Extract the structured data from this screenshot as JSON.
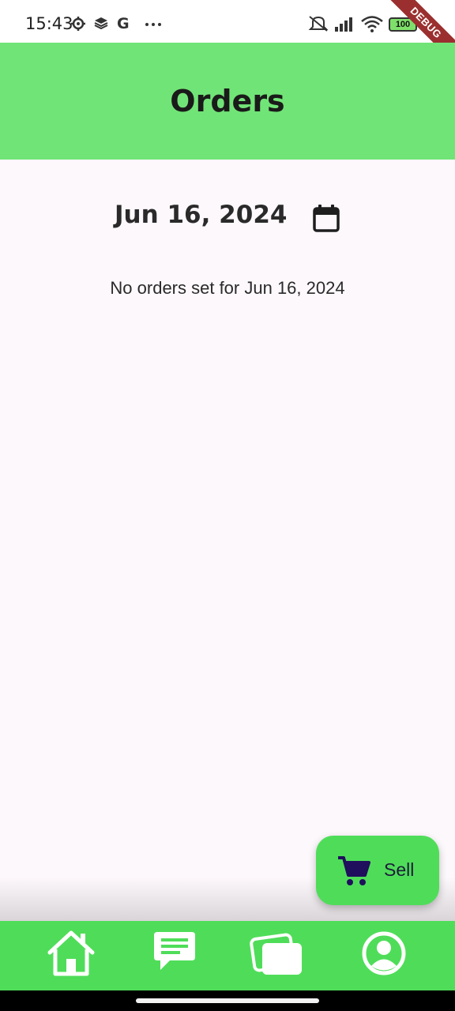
{
  "status_bar": {
    "time": "15:43",
    "battery": "100",
    "icons": [
      "gear-icon",
      "layers-icon",
      "google-icon",
      "more-icon",
      "mute-icon",
      "signal-icon",
      "wifi-icon",
      "battery-icon"
    ]
  },
  "debug_banner": "DEBUG",
  "app_bar": {
    "title": "Orders"
  },
  "date_picker": {
    "date": "Jun 16, 2024",
    "icon": "calendar-icon"
  },
  "empty_state": {
    "message": "No orders set for Jun 16, 2024"
  },
  "fab": {
    "label": "Sell",
    "icon": "cart-icon"
  },
  "bottom_nav": {
    "items": [
      {
        "icon": "home-icon"
      },
      {
        "icon": "chat-icon"
      },
      {
        "icon": "cards-icon"
      },
      {
        "icon": "profile-icon"
      }
    ]
  },
  "colors": {
    "app_bar": "#71e477",
    "accent_green": "#4fdd59",
    "background": "#fdf8fc",
    "fab_label": "#1b1b3a",
    "cart_icon": "#1f0f5c"
  }
}
